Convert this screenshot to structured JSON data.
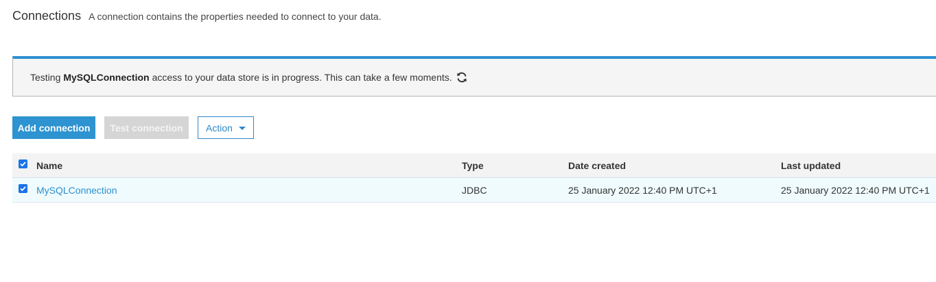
{
  "header": {
    "title": "Connections",
    "subtitle": "A connection contains the properties needed to connect to your data."
  },
  "alert": {
    "prefix": "Testing",
    "connection_name": "MySQLConnection",
    "suffix": "access to your data store is in progress. This can take a few moments.",
    "accent_color": "#2b8fd1"
  },
  "toolbar": {
    "add_label": "Add connection",
    "test_label": "Test connection",
    "action_label": "Action"
  },
  "table": {
    "columns": {
      "name": "Name",
      "type": "Type",
      "date_created": "Date created",
      "last_updated": "Last updated"
    },
    "rows": [
      {
        "selected": true,
        "name": "MySQLConnection",
        "type": "JDBC",
        "date_created": "25 January 2022 12:40 PM UTC+1",
        "last_updated": "25 January 2022 12:40 PM UTC+1"
      }
    ]
  },
  "colors": {
    "primary": "#2e93d1",
    "link": "#2b8fd1",
    "checkbox": "#1a73e8",
    "selected_row_bg": "#f0fbfd"
  },
  "icons": {
    "alert_icon": "refresh-icon",
    "action_icon": "caret-down-icon",
    "checkbox_icon": "checkmark-icon"
  }
}
